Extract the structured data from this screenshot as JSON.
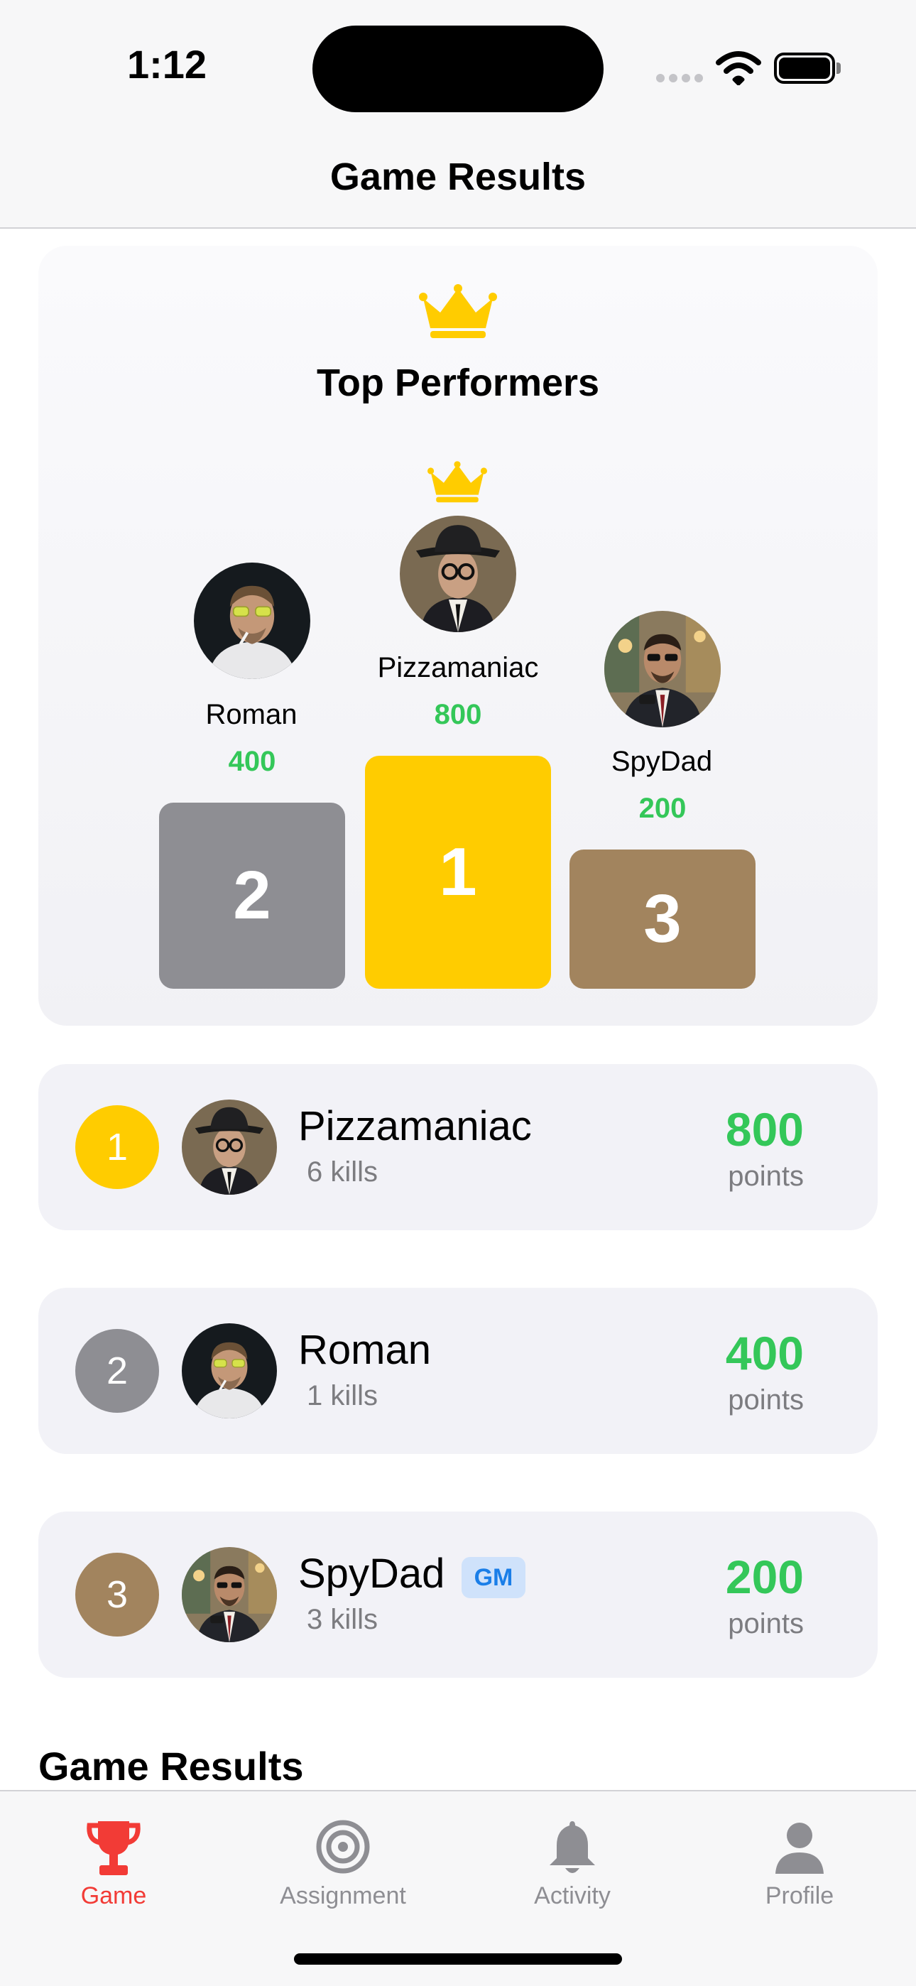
{
  "status_bar": {
    "time": "1:12"
  },
  "nav": {
    "title": "Game Results"
  },
  "podium": {
    "title": "Top Performers",
    "first": {
      "name": "Pizzamaniac",
      "points": "800",
      "place": "1"
    },
    "second": {
      "name": "Roman",
      "points": "400",
      "place": "2"
    },
    "third": {
      "name": "SpyDad",
      "points": "200",
      "place": "3"
    }
  },
  "rankings": [
    {
      "rank": "1",
      "name": "Pizzamaniac",
      "kills": "6 kills",
      "points": "800",
      "points_label": "points"
    },
    {
      "rank": "2",
      "name": "Roman",
      "kills": "1 kills",
      "points": "400",
      "points_label": "points"
    },
    {
      "rank": "3",
      "name": "SpyDad",
      "kills": "3 kills",
      "points": "200",
      "points_label": "points",
      "badge": "GM"
    }
  ],
  "section": {
    "title": "Game Results"
  },
  "tabs": [
    {
      "label": "Game",
      "icon": "trophy-icon",
      "active": true
    },
    {
      "label": "Assignment",
      "icon": "target-icon"
    },
    {
      "label": "Activity",
      "icon": "bell-icon"
    },
    {
      "label": "Profile",
      "icon": "person-icon"
    }
  ],
  "colors": {
    "gold": "#ffcc00",
    "silver": "#8e8e93",
    "bronze": "#a2845e",
    "points_green": "#34c759",
    "active_tab": "#f23b36",
    "gm_badge": "#1a7ee8"
  }
}
